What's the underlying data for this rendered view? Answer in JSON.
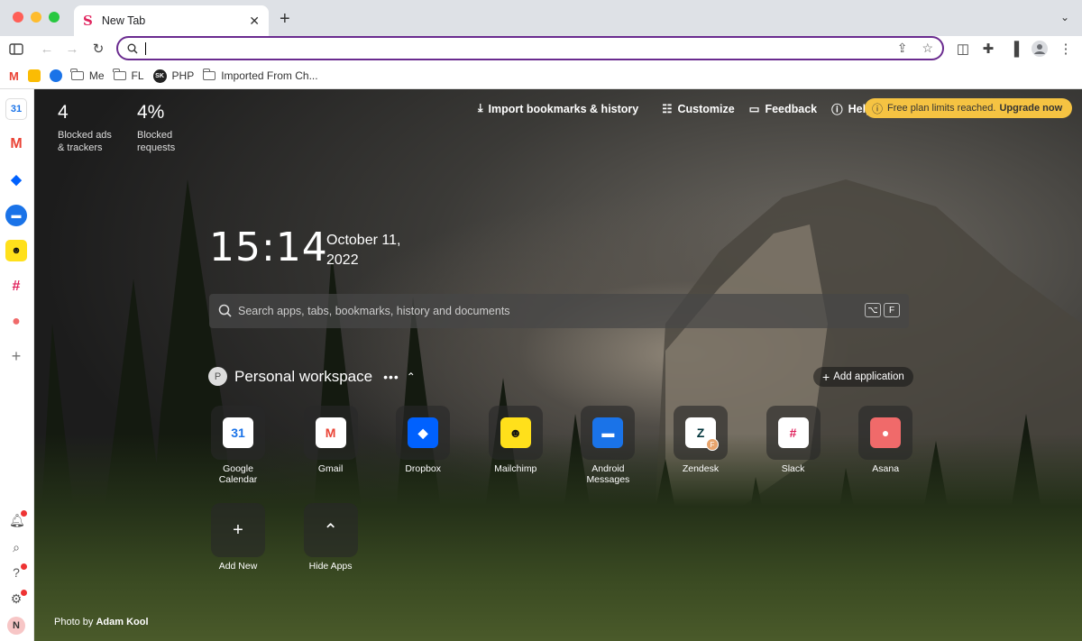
{
  "browser": {
    "tab_title": "New Tab",
    "tab_favicon": "S",
    "address_value": "",
    "bookmarks": [
      "Me",
      "FL",
      "PHP",
      "Imported From Ch..."
    ],
    "bookmark_sk_badge": "SK"
  },
  "stats": [
    {
      "value": "4",
      "label": "Blocked ads & trackers"
    },
    {
      "value": "4%",
      "label": "Blocked requests"
    }
  ],
  "topnav": {
    "import": "Import bookmarks & history",
    "customize": "Customize",
    "feedback": "Feedback",
    "help": "Help",
    "plan_notice": "Free plan limits reached.",
    "upgrade": "Upgrade now"
  },
  "clock": {
    "time": "15:14",
    "date": "October 11, 2022"
  },
  "search": {
    "placeholder": "Search apps, tabs, bookmarks, history and documents",
    "key1": "⌥",
    "key2": "F"
  },
  "workspace": {
    "initial": "P",
    "name": "Personal workspace",
    "add_application": "Add application"
  },
  "apps": [
    {
      "name": "Google Calendar",
      "glyph": "31",
      "color": "#ffffff",
      "text_color": "#1a73e8"
    },
    {
      "name": "Gmail",
      "glyph": "M",
      "color": "#ffffff",
      "text_color": "#ea4335"
    },
    {
      "name": "Dropbox",
      "glyph": "◆",
      "color": "#0061fe",
      "text_color": "#ffffff"
    },
    {
      "name": "Mailchimp",
      "glyph": "☻",
      "color": "#ffe01b",
      "text_color": "#111111"
    },
    {
      "name": "Android Messages",
      "glyph": "▬",
      "color": "#1a73e8",
      "text_color": "#ffffff"
    },
    {
      "name": "Zendesk",
      "glyph": "Z",
      "color": "#ffffff",
      "text_color": "#03363d",
      "badge": "F"
    },
    {
      "name": "Slack",
      "glyph": "#",
      "color": "#ffffff",
      "text_color": "#e01e5a"
    },
    {
      "name": "Asana",
      "glyph": "●",
      "color": "#f06a6a",
      "text_color": "#ffffff"
    }
  ],
  "controls": [
    {
      "name": "Add New",
      "glyph": "+"
    },
    {
      "name": "Hide Apps",
      "glyph": "⌃"
    }
  ],
  "credit": {
    "prefix": "Photo by",
    "author": "Adam Kool"
  },
  "user_initial": "N"
}
